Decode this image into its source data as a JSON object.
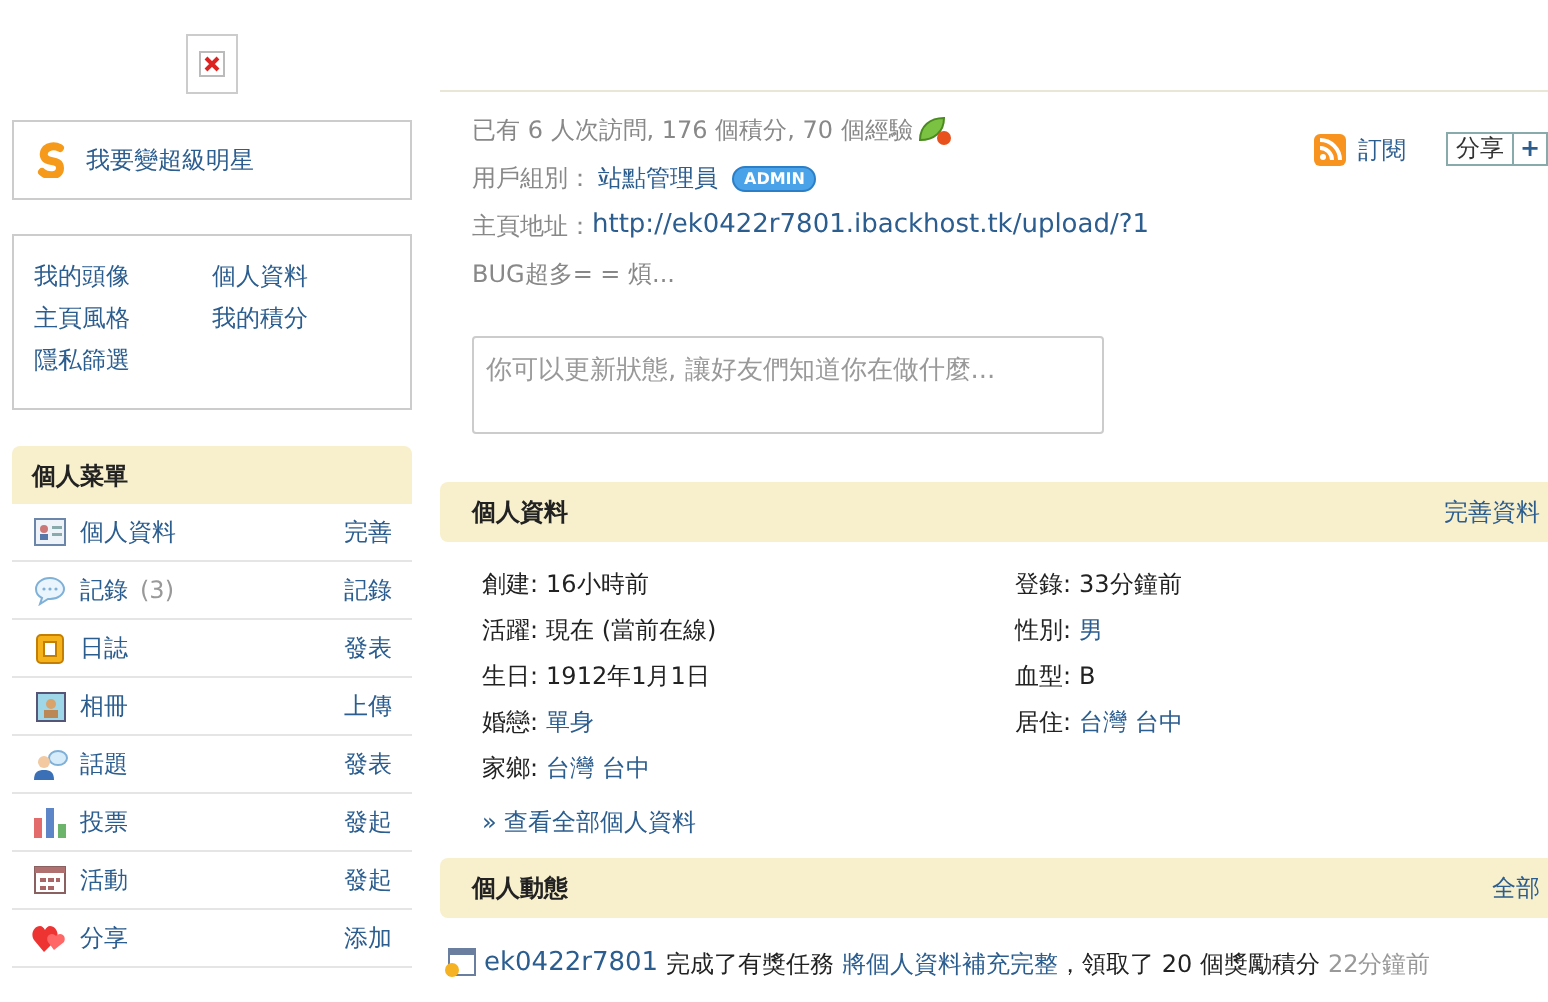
{
  "star_link": {
    "label": "我要變超級明星"
  },
  "quick_links": [
    "我的頭像",
    "個人資料",
    "主頁風格",
    "我的積分",
    "隱私篩選"
  ],
  "menu": {
    "title": "個人菜單",
    "items": [
      {
        "kind": "profile",
        "label": "個人資料",
        "action": "完善"
      },
      {
        "kind": "comment",
        "label": "記錄",
        "count": "(3)",
        "action": "記錄"
      },
      {
        "kind": "blog",
        "label": "日誌",
        "action": "發表"
      },
      {
        "kind": "album",
        "label": "相冊",
        "action": "上傳"
      },
      {
        "kind": "topic",
        "label": "話題",
        "action": "發表"
      },
      {
        "kind": "poll",
        "label": "投票",
        "action": "發起"
      },
      {
        "kind": "event",
        "label": "活動",
        "action": "發起"
      },
      {
        "kind": "share",
        "label": "分享",
        "action": "添加"
      }
    ]
  },
  "summary": {
    "stats": "已有 6 人次訪問, 176 個積分, 70 個經驗",
    "group_label": "用戶組別：",
    "group": "站點管理員",
    "badge": "ADMIN",
    "homepage_label": "主頁地址：",
    "homepage": "http://ek0422r7801.ibackhost.tk/upload/?1",
    "status_text": "BUG超多= = 煩..."
  },
  "subscribe": "訂閱",
  "share": {
    "label": "分享",
    "plus": "+"
  },
  "status_input": {
    "placeholder": "你可以更新狀態, 讓好友們知道你在做什麼..."
  },
  "profile_section": {
    "title": "個人資料",
    "action": "完善資料",
    "fields": [
      {
        "label": "創建:",
        "value": "16小時前",
        "link": false
      },
      {
        "label": "登錄:",
        "value": "33分鐘前",
        "link": false
      },
      {
        "label": "活躍:",
        "value": "現在 (當前在線)",
        "link": false
      },
      {
        "label": "性別:",
        "value": "男",
        "link": true
      },
      {
        "label": "生日:",
        "value": "1912年1月1日",
        "link": false
      },
      {
        "label": "血型:",
        "value": "B",
        "link": false
      },
      {
        "label": "婚戀:",
        "value": "單身",
        "link": true
      },
      {
        "label": "居住:",
        "value": "台灣 台中",
        "link": true
      },
      {
        "label": "家鄉:",
        "value": "台灣 台中",
        "link": true
      }
    ],
    "more_link": "» 查看全部個人資料"
  },
  "activity_section": {
    "title": "個人動態",
    "action": "全部",
    "items": [
      {
        "user": "ek0422r7801",
        "text": "完成了有獎任務",
        "task": "將個人資料補充完整",
        "result": "，領取了 20 個獎勵積分",
        "time": "22分鐘前"
      }
    ]
  }
}
